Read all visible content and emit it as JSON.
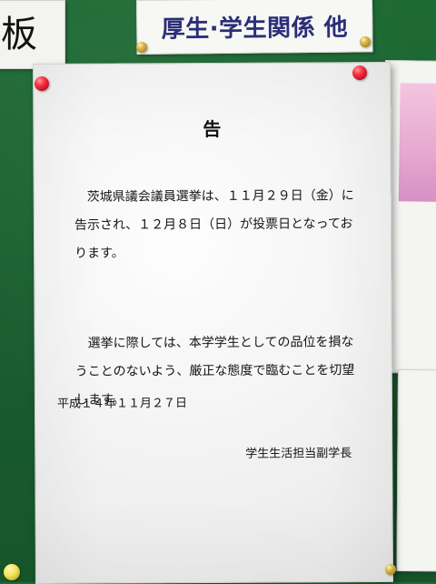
{
  "signs": {
    "top_left": "板",
    "top_center": "厚生·学生関係 他"
  },
  "notice": {
    "title": "告",
    "paragraph_1": "　茨城県議会議員選挙は、１１月２９日（金）に告示され、１２月８日（日）が投票日となっております。",
    "paragraph_2": "　選挙に際しては、本学学生としての品位を損なうことのないよう、厳正な態度で臨むことを切望します。",
    "date": "平成１４年１１月２７日",
    "signature": "学生生活担当副学長"
  },
  "colors": {
    "board_green": "#1f6b35",
    "sign_blue_text": "#2a2e78",
    "paper": "#f1f1f1",
    "pin_red": "#ff2f3f",
    "pin_gold": "#d5b74a",
    "pin_yellow": "#f2e35b",
    "pink_accent": "#e7a6cf"
  }
}
